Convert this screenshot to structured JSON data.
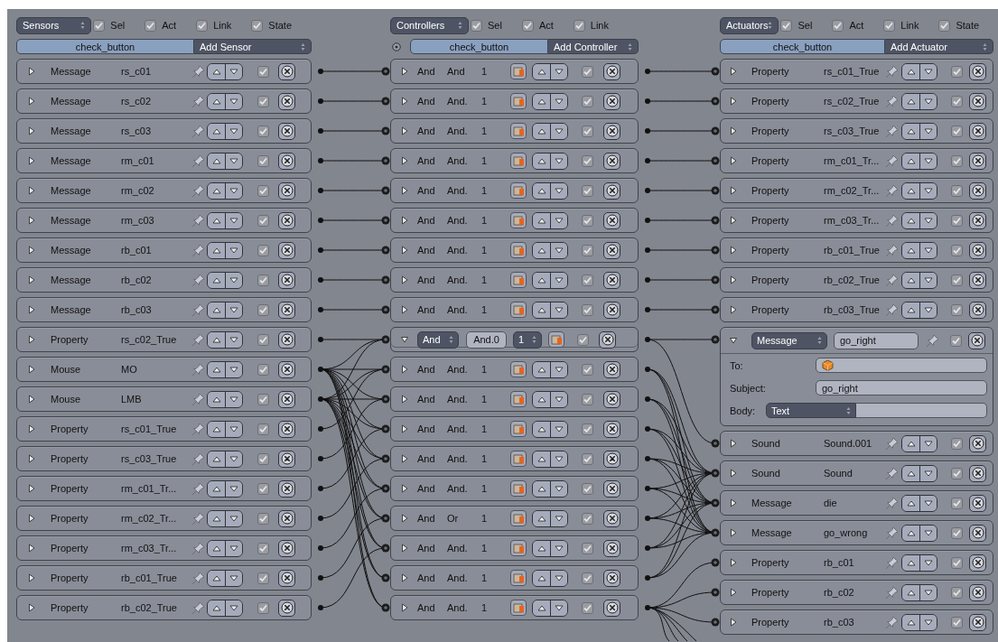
{
  "sensors": {
    "menu": "Sensors",
    "filters": [
      {
        "label": "Sel",
        "checked": true
      },
      {
        "label": "Act",
        "checked": true
      },
      {
        "label": "Link",
        "checked": true
      },
      {
        "label": "State",
        "checked": true
      }
    ],
    "object_button": "check_button",
    "add_menu": "Add Sensor",
    "items": [
      {
        "type": "Message",
        "name": "rs_c01",
        "expanded": false,
        "active": true
      },
      {
        "type": "Message",
        "name": "rs_c02",
        "expanded": false,
        "active": true
      },
      {
        "type": "Message",
        "name": "rs_c03",
        "expanded": false,
        "active": true
      },
      {
        "type": "Message",
        "name": "rm_c01",
        "expanded": false,
        "active": true
      },
      {
        "type": "Message",
        "name": "rm_c02",
        "expanded": false,
        "active": true
      },
      {
        "type": "Message",
        "name": "rm_c03",
        "expanded": false,
        "active": true
      },
      {
        "type": "Message",
        "name": "rb_c01",
        "expanded": false,
        "active": true
      },
      {
        "type": "Message",
        "name": "rb_c02",
        "expanded": false,
        "active": true
      },
      {
        "type": "Message",
        "name": "rb_c03",
        "expanded": false,
        "active": true
      },
      {
        "type": "Property",
        "name": "rs_c02_True",
        "expanded": false,
        "active": true
      },
      {
        "type": "Mouse",
        "name": "MO",
        "expanded": false,
        "active": true
      },
      {
        "type": "Mouse",
        "name": "LMB",
        "expanded": false,
        "active": true
      },
      {
        "type": "Property",
        "name": "rs_c01_True",
        "expanded": false,
        "active": true
      },
      {
        "type": "Property",
        "name": "rs_c03_True",
        "expanded": false,
        "active": true
      },
      {
        "type": "Property",
        "name": "rm_c01_Tr...",
        "expanded": false,
        "active": true
      },
      {
        "type": "Property",
        "name": "rm_c02_Tr...",
        "expanded": false,
        "active": true
      },
      {
        "type": "Property",
        "name": "rm_c03_Tr...",
        "expanded": false,
        "active": true
      },
      {
        "type": "Property",
        "name": "rb_c01_True",
        "expanded": false,
        "active": true
      },
      {
        "type": "Property",
        "name": "rb_c02_True",
        "expanded": false,
        "active": true
      }
    ]
  },
  "controllers": {
    "menu": "Controllers",
    "filters": [
      {
        "label": "Sel",
        "checked": true
      },
      {
        "label": "Act",
        "checked": true
      },
      {
        "label": "Link",
        "checked": true
      }
    ],
    "object_button": "check_button",
    "add_menu": "Add Controller",
    "items": [
      {
        "type": "And",
        "name": "And",
        "state": "1",
        "expanded": false,
        "active": true
      },
      {
        "type": "And",
        "name": "And.",
        "state": "1",
        "expanded": false,
        "active": true
      },
      {
        "type": "And",
        "name": "And.",
        "state": "1",
        "expanded": false,
        "active": true
      },
      {
        "type": "And",
        "name": "And.",
        "state": "1",
        "expanded": false,
        "active": true
      },
      {
        "type": "And",
        "name": "And.",
        "state": "1",
        "expanded": false,
        "active": true
      },
      {
        "type": "And",
        "name": "And.",
        "state": "1",
        "expanded": false,
        "active": true
      },
      {
        "type": "And",
        "name": "And.",
        "state": "1",
        "expanded": false,
        "active": true
      },
      {
        "type": "And",
        "name": "And.",
        "state": "1",
        "expanded": false,
        "active": true
      },
      {
        "type": "And",
        "name": "And.",
        "state": "1",
        "expanded": false,
        "active": true
      },
      {
        "type": "And",
        "name": "And.0",
        "state": "1",
        "expanded": true,
        "active": true
      },
      {
        "type": "And",
        "name": "And.",
        "state": "1",
        "expanded": false,
        "active": true
      },
      {
        "type": "And",
        "name": "And.",
        "state": "1",
        "expanded": false,
        "active": true
      },
      {
        "type": "And",
        "name": "And.",
        "state": "1",
        "expanded": false,
        "active": true
      },
      {
        "type": "And",
        "name": "And.",
        "state": "1",
        "expanded": false,
        "active": true
      },
      {
        "type": "And",
        "name": "And.",
        "state": "1",
        "expanded": false,
        "active": true
      },
      {
        "type": "And",
        "name": "Or",
        "state": "1",
        "expanded": false,
        "active": true
      },
      {
        "type": "And",
        "name": "And.",
        "state": "1",
        "expanded": false,
        "active": true
      },
      {
        "type": "And",
        "name": "And.",
        "state": "1",
        "expanded": false,
        "active": true
      },
      {
        "type": "And",
        "name": "And.",
        "state": "1",
        "expanded": false,
        "active": true
      }
    ]
  },
  "actuators": {
    "menu": "Actuators",
    "filters": [
      {
        "label": "Sel",
        "checked": true
      },
      {
        "label": "Act",
        "checked": true
      },
      {
        "label": "Link",
        "checked": true
      },
      {
        "label": "State",
        "checked": true
      }
    ],
    "object_button": "check_button",
    "add_menu": "Add Actuator",
    "items": [
      {
        "type": "Property",
        "name": "rs_c01_True",
        "expanded": false,
        "active": true
      },
      {
        "type": "Property",
        "name": "rs_c02_True",
        "expanded": false,
        "active": true
      },
      {
        "type": "Property",
        "name": "rs_c03_True",
        "expanded": false,
        "active": true
      },
      {
        "type": "Property",
        "name": "rm_c01_Tr...",
        "expanded": false,
        "active": true
      },
      {
        "type": "Property",
        "name": "rm_c02_Tr...",
        "expanded": false,
        "active": true
      },
      {
        "type": "Property",
        "name": "rm_c03_Tr...",
        "expanded": false,
        "active": true
      },
      {
        "type": "Property",
        "name": "rb_c01_True",
        "expanded": false,
        "active": true
      },
      {
        "type": "Property",
        "name": "rb_c02_True",
        "expanded": false,
        "active": true
      },
      {
        "type": "Property",
        "name": "rb_c03_True",
        "expanded": false,
        "active": true
      },
      {
        "type": "Message",
        "name": "go_right",
        "expanded": true,
        "active": true,
        "details": [
          {
            "kind": "object",
            "label": "To:"
          },
          {
            "kind": "text",
            "label": "Subject:",
            "value": "go_right"
          },
          {
            "kind": "menu",
            "label": "Body:",
            "value": "Text"
          }
        ]
      },
      {
        "type": "Sound",
        "name": "Sound.001",
        "expanded": false,
        "active": true
      },
      {
        "type": "Sound",
        "name": "Sound",
        "expanded": false,
        "active": true
      },
      {
        "type": "Message",
        "name": "die",
        "expanded": false,
        "active": true
      },
      {
        "type": "Message",
        "name": "go_wrong",
        "expanded": false,
        "active": true
      },
      {
        "type": "Property",
        "name": "rb_c01",
        "expanded": false,
        "active": true
      },
      {
        "type": "Property",
        "name": "rb_c02",
        "expanded": false,
        "active": true
      },
      {
        "type": "Property",
        "name": "rb_c03",
        "expanded": false,
        "active": true
      }
    ]
  }
}
